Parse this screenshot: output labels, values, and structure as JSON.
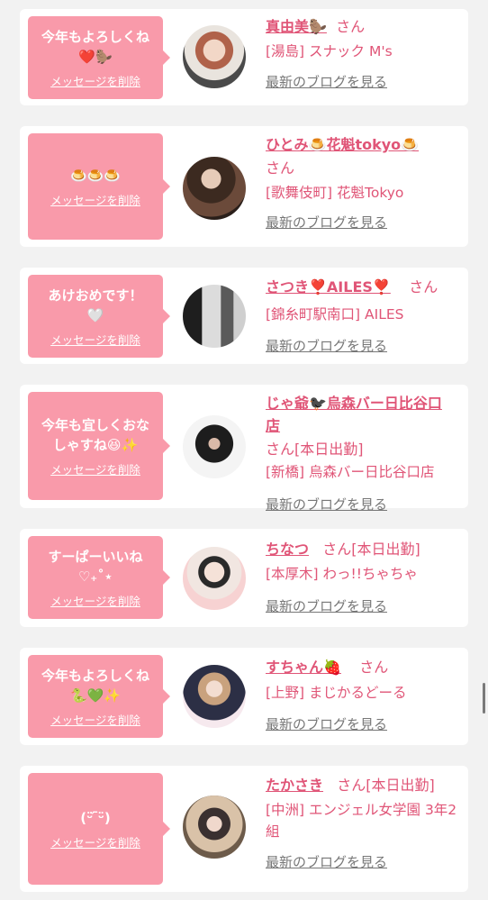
{
  "delete_label": "メッセージを削除",
  "blog_label": "最新のブログを見る",
  "san": "さん",
  "cards": [
    {
      "message": "今年もよろしくね\n❤️🦫",
      "name": "真由美🦫",
      "status": "",
      "shop": "[湯島] スナック M's"
    },
    {
      "message": "🍮🍮🍮",
      "name": "ひとみ🍮花魁tokyo🍮",
      "status": "",
      "shop": "[歌舞伎町] 花魁Tokyo"
    },
    {
      "message": "あけおめです！\n🤍",
      "name": "さつき❣️AILES❣️",
      "status": "",
      "shop": "[錦糸町駅南口] AILES"
    },
    {
      "message": "今年も宜しくおな\nしゃすね😆✨",
      "name": "じゃ爺🐦‍⬛烏森バー日比谷口店",
      "status": "[本日出勤]",
      "shop": "[新橋] 烏森バー日比谷口店"
    },
    {
      "message": "すーぱーいいね\n♡₊˚⋆",
      "name": "ちなつ",
      "status": "[本日出勤]",
      "shop": "[本厚木] わっ!!ちゃちゃ"
    },
    {
      "message": "今年もよろしくね\n🐍💚✨",
      "name": "すちゃん🍓",
      "status": "",
      "shop": "[上野] まじかるどーる"
    },
    {
      "message": "(ᵕ̈ ᷇ᵕ̈)",
      "name": "たかさき",
      "status": "[本日出勤]",
      "shop": "[中洲] エンジェル女学園 3年2組"
    }
  ]
}
